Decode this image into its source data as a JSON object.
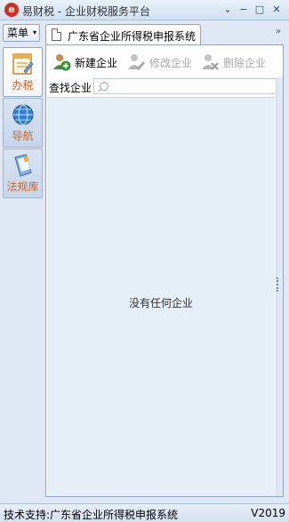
{
  "window": {
    "app_logo": "e",
    "title": "易财税 - 企业财税服务平台",
    "controls": {
      "collapse": "⌄",
      "minimize": "−",
      "maximize": "□",
      "close": "✕"
    }
  },
  "menu": {
    "label": "菜单",
    "arrow": "▾"
  },
  "leftnav": {
    "items": [
      {
        "label": "办税",
        "icon": "tax-form-icon"
      },
      {
        "label": "导航",
        "icon": "globe-icon"
      },
      {
        "label": "法规库",
        "icon": "law-book-icon"
      }
    ]
  },
  "tab": {
    "label": "广东省企业所得税申报系统"
  },
  "toolbar": {
    "new_label": "新建企业",
    "edit_label": "修改企业",
    "delete_label": "删除企业"
  },
  "search": {
    "label": "查找企业",
    "placeholder": ""
  },
  "list": {
    "empty_text": "没有任何企业"
  },
  "statusbar": {
    "support_text": "技术支持:广东省企业所得税申报系统",
    "version": "V2019"
  },
  "colors": {
    "accent_orange": "#d5621f",
    "panel_bg": "#e6eef8",
    "logo_red": "#d92a1f"
  }
}
